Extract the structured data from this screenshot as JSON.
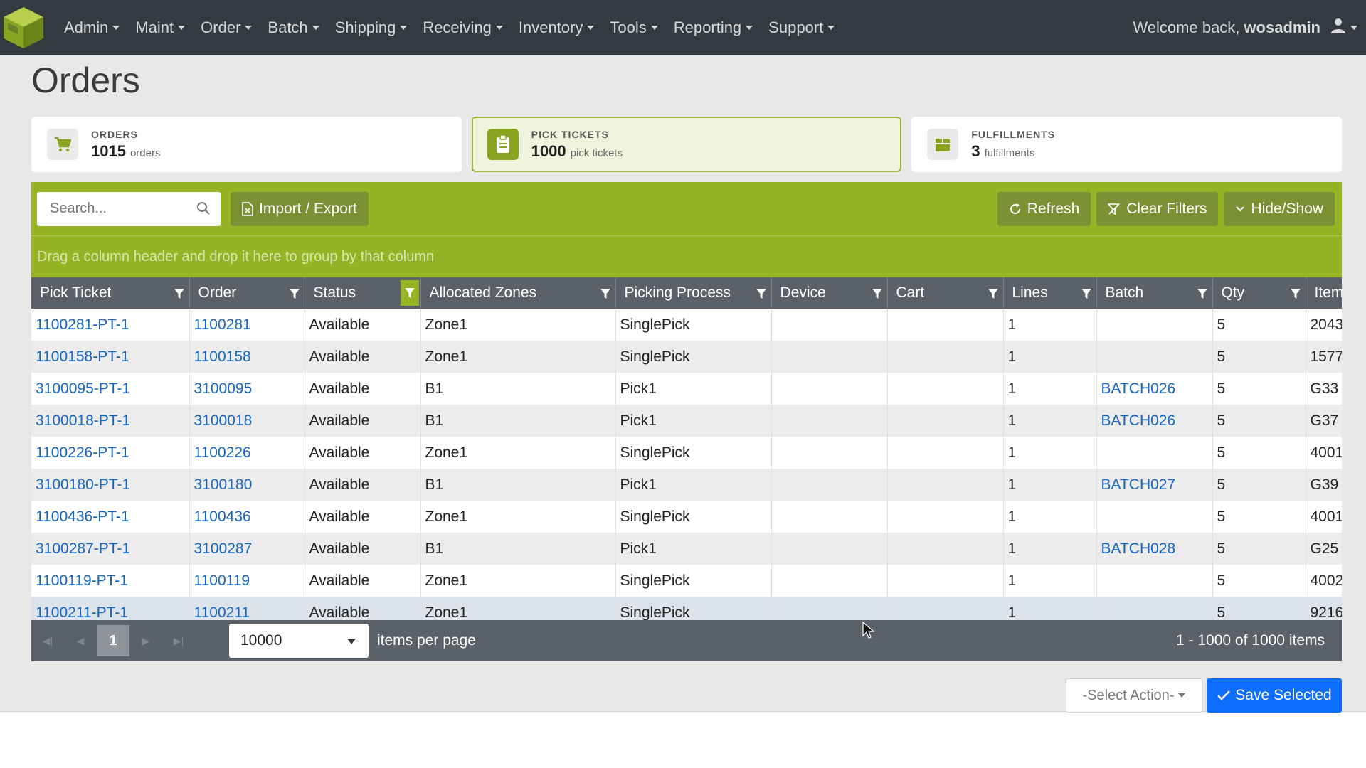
{
  "nav": {
    "items": [
      "Admin",
      "Maint",
      "Order",
      "Batch",
      "Shipping",
      "Receiving",
      "Inventory",
      "Tools",
      "Reporting",
      "Support"
    ],
    "welcome_prefix": "Welcome back,",
    "username": "wosadmin"
  },
  "page": {
    "title": "Orders"
  },
  "cards": [
    {
      "label": "ORDERS",
      "count": "1015",
      "unit": "orders",
      "icon": "cart-icon"
    },
    {
      "label": "PICK TICKETS",
      "count": "1000",
      "unit": "pick tickets",
      "icon": "clipboard-icon"
    },
    {
      "label": "FULFILLMENTS",
      "count": "3",
      "unit": "fulfillments",
      "icon": "box-icon"
    }
  ],
  "toolbar": {
    "search_placeholder": "Search...",
    "import_export": "Import / Export",
    "refresh": "Refresh",
    "clear_filters": "Clear Filters",
    "hide_show": "Hide/Show",
    "group_hint": "Drag a column header and drop it here to group by that column"
  },
  "table": {
    "columns": [
      "Pick Ticket",
      "Order",
      "Status",
      "Allocated Zones",
      "Picking Process",
      "Device",
      "Cart",
      "Lines",
      "Batch",
      "Qty",
      "Item"
    ],
    "rows": [
      [
        "1100281-PT-1",
        "1100281",
        "Available",
        "Zone1",
        "SinglePick",
        "",
        "",
        "1",
        "",
        "5",
        "2043"
      ],
      [
        "1100158-PT-1",
        "1100158",
        "Available",
        "Zone1",
        "SinglePick",
        "",
        "",
        "1",
        "",
        "5",
        "1577"
      ],
      [
        "3100095-PT-1",
        "3100095",
        "Available",
        "B1",
        "Pick1",
        "",
        "",
        "1",
        "BATCH026",
        "5",
        "G33"
      ],
      [
        "3100018-PT-1",
        "3100018",
        "Available",
        "B1",
        "Pick1",
        "",
        "",
        "1",
        "BATCH026",
        "5",
        "G37"
      ],
      [
        "1100226-PT-1",
        "1100226",
        "Available",
        "Zone1",
        "SinglePick",
        "",
        "",
        "1",
        "",
        "5",
        "4001"
      ],
      [
        "3100180-PT-1",
        "3100180",
        "Available",
        "B1",
        "Pick1",
        "",
        "",
        "1",
        "BATCH027",
        "5",
        "G39"
      ],
      [
        "1100436-PT-1",
        "1100436",
        "Available",
        "Zone1",
        "SinglePick",
        "",
        "",
        "1",
        "",
        "5",
        "4001"
      ],
      [
        "3100287-PT-1",
        "3100287",
        "Available",
        "B1",
        "Pick1",
        "",
        "",
        "1",
        "BATCH028",
        "5",
        "G25"
      ],
      [
        "1100119-PT-1",
        "1100119",
        "Available",
        "Zone1",
        "SinglePick",
        "",
        "",
        "1",
        "",
        "5",
        "4002"
      ],
      [
        "1100211-PT-1",
        "1100211",
        "Available",
        "Zone1",
        "SinglePick",
        "",
        "",
        "1",
        "",
        "5",
        "9216"
      ]
    ]
  },
  "pager": {
    "current_page": "1",
    "page_size": "10000",
    "items_per_page_label": "items per page",
    "info": "1 - 1000 of 1000 items"
  },
  "actions": {
    "select_action": "-Select Action-",
    "save_selected": "Save Selected"
  },
  "colors": {
    "accent": "#96b325",
    "header": "#343a40",
    "link": "#1565c0",
    "primary": "#0d6efd"
  }
}
